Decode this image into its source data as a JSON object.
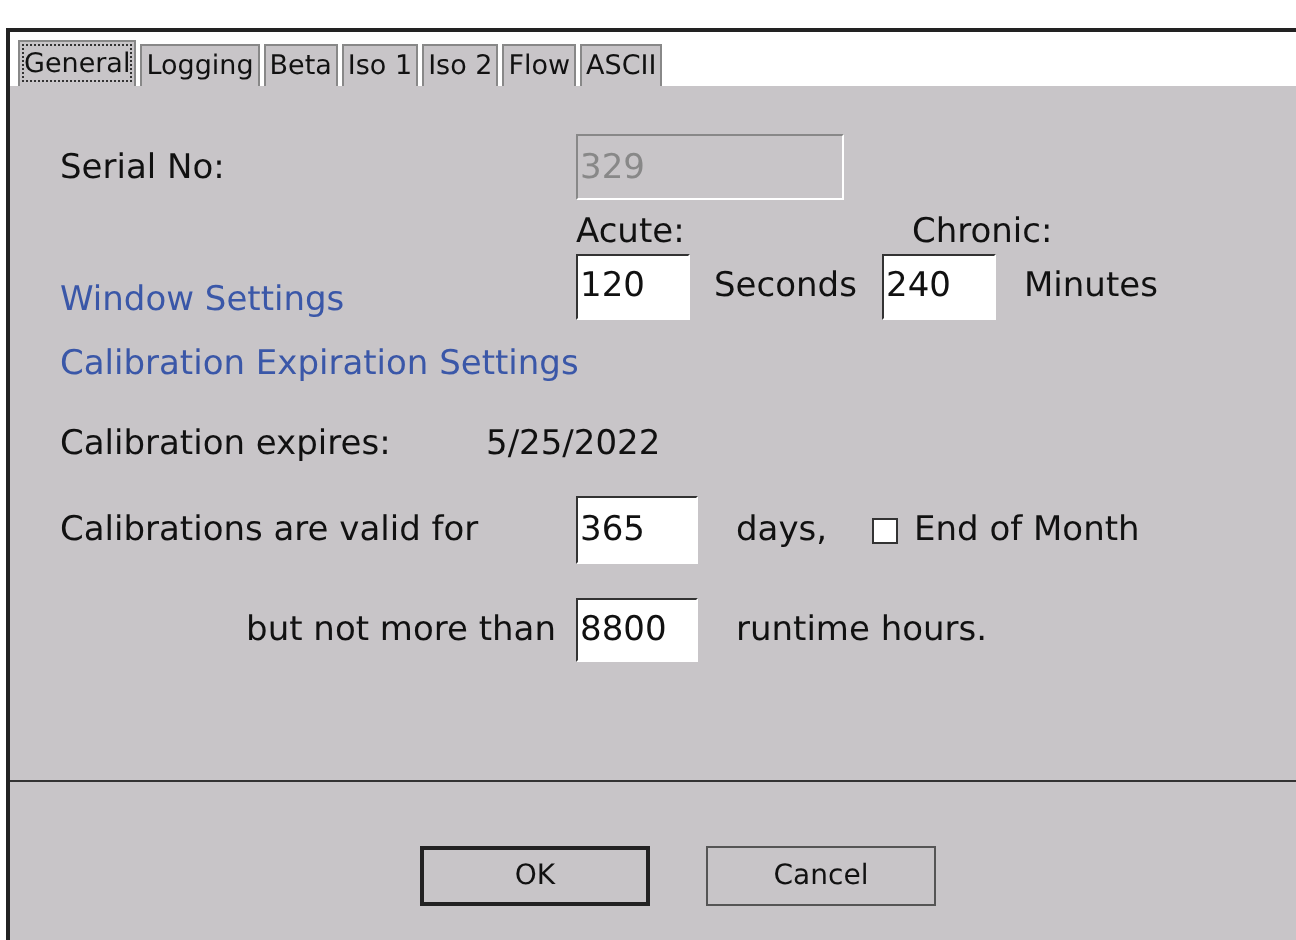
{
  "tabs": [
    {
      "label": "General",
      "selected": true
    },
    {
      "label": "Logging",
      "selected": false
    },
    {
      "label": "Beta",
      "selected": false
    },
    {
      "label": "Iso 1",
      "selected": false
    },
    {
      "label": "Iso 2",
      "selected": false
    },
    {
      "label": "Flow",
      "selected": false
    },
    {
      "label": "ASCII",
      "selected": false
    }
  ],
  "serial": {
    "label": "Serial No:",
    "value": "329",
    "disabled": true
  },
  "window_settings": {
    "heading": "Window Settings",
    "acute_label": "Acute:",
    "acute_value": "120",
    "acute_unit": "Seconds",
    "chronic_label": "Chronic:",
    "chronic_value": "240",
    "chronic_unit": "Minutes"
  },
  "calibration": {
    "heading": "Calibration Expiration Settings",
    "expires_label": "Calibration expires:",
    "expires_value": "5/25/2022",
    "valid_label": "Calibrations are valid for",
    "days_value": "365",
    "days_unit": "days,",
    "end_of_month": {
      "label": "End of Month",
      "checked": false
    },
    "max_label": "but not more than",
    "hours_value": "8800",
    "hours_unit": "runtime hours."
  },
  "buttons": [
    "OK",
    "Cancel"
  ]
}
